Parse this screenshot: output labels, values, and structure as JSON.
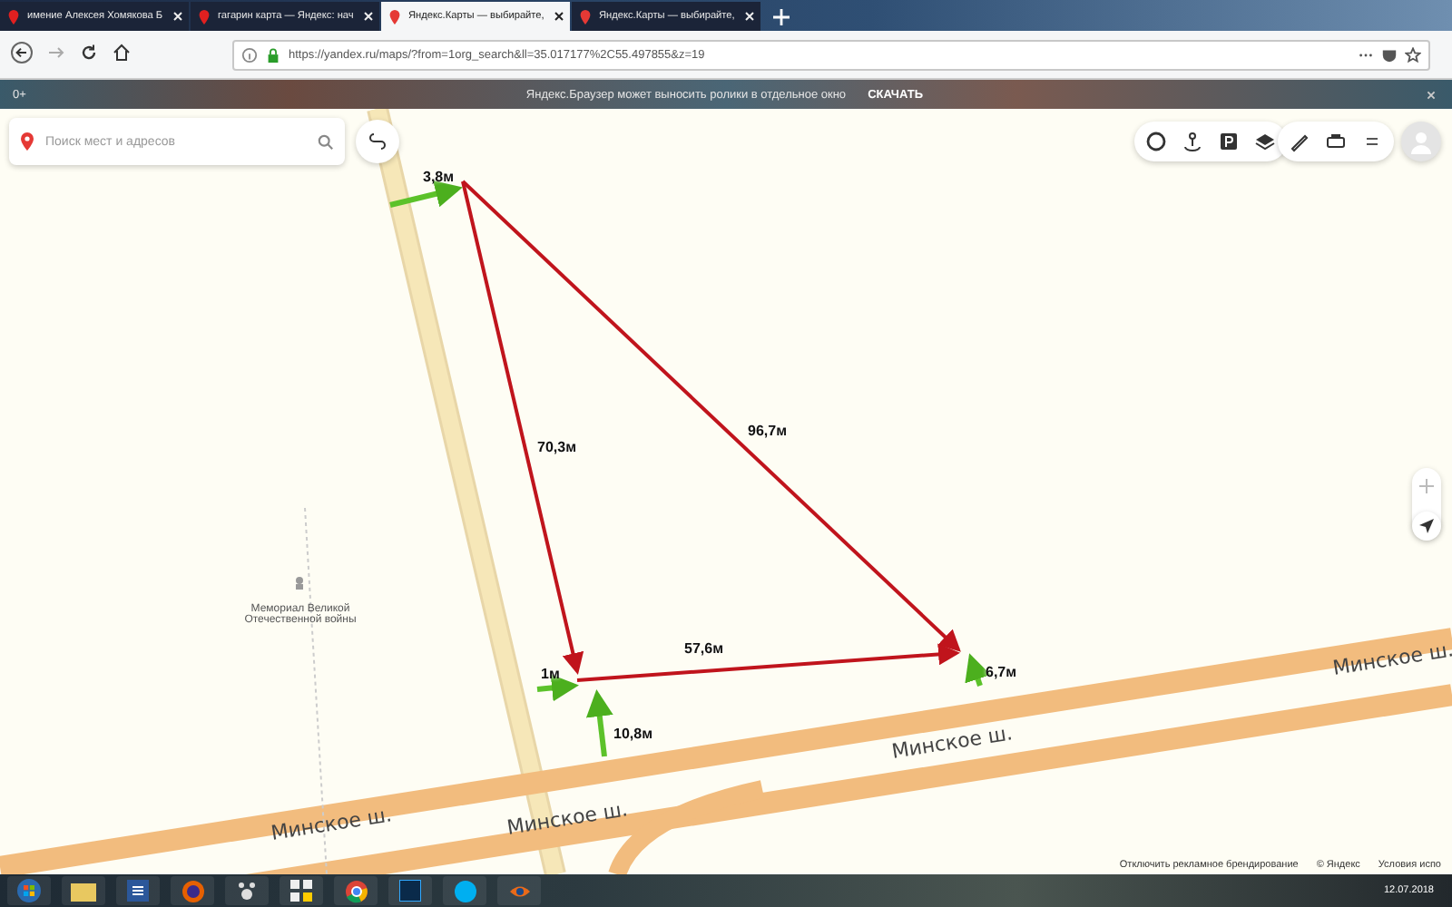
{
  "tabs": [
    {
      "title": "имение Алексея Хомякова Б",
      "selected": false
    },
    {
      "title": "гагарин карта — Яндекс: нач",
      "selected": false
    },
    {
      "title": "Яндекс.Карты — выбирайте, ",
      "selected": true
    },
    {
      "title": "Яндекс.Карты — выбирайте, ",
      "selected": false
    }
  ],
  "address": {
    "url": "https://yandex.ru/maps/?from=1org_search&ll=35.017177%2C55.497855&z=19"
  },
  "banner": {
    "age": "0+",
    "text": "Яндекс.Браузер может выносить ролики в отдельное окно",
    "action": "СКАЧАТЬ"
  },
  "search": {
    "placeholder": "Поиск мест и адресов"
  },
  "measurements": [
    {
      "label": "3,8м"
    },
    {
      "label": "70,3м"
    },
    {
      "label": "96,7м"
    },
    {
      "label": "57,6м"
    },
    {
      "label": "1м"
    },
    {
      "label": "10,8м"
    },
    {
      "label": "6,7м"
    }
  ],
  "roads": [
    {
      "name": "Минское ш."
    },
    {
      "name": "Минское ш."
    },
    {
      "name": "Минское ш."
    },
    {
      "name": "Минское ш."
    }
  ],
  "poi": {
    "name": "Мемориал Великой Отечественной войны"
  },
  "footer": {
    "links": [
      "Отключить рекламное брендирование",
      "© Яндекс",
      "Условия испо"
    ]
  },
  "taskbar": {
    "date": "12.07.2018"
  }
}
